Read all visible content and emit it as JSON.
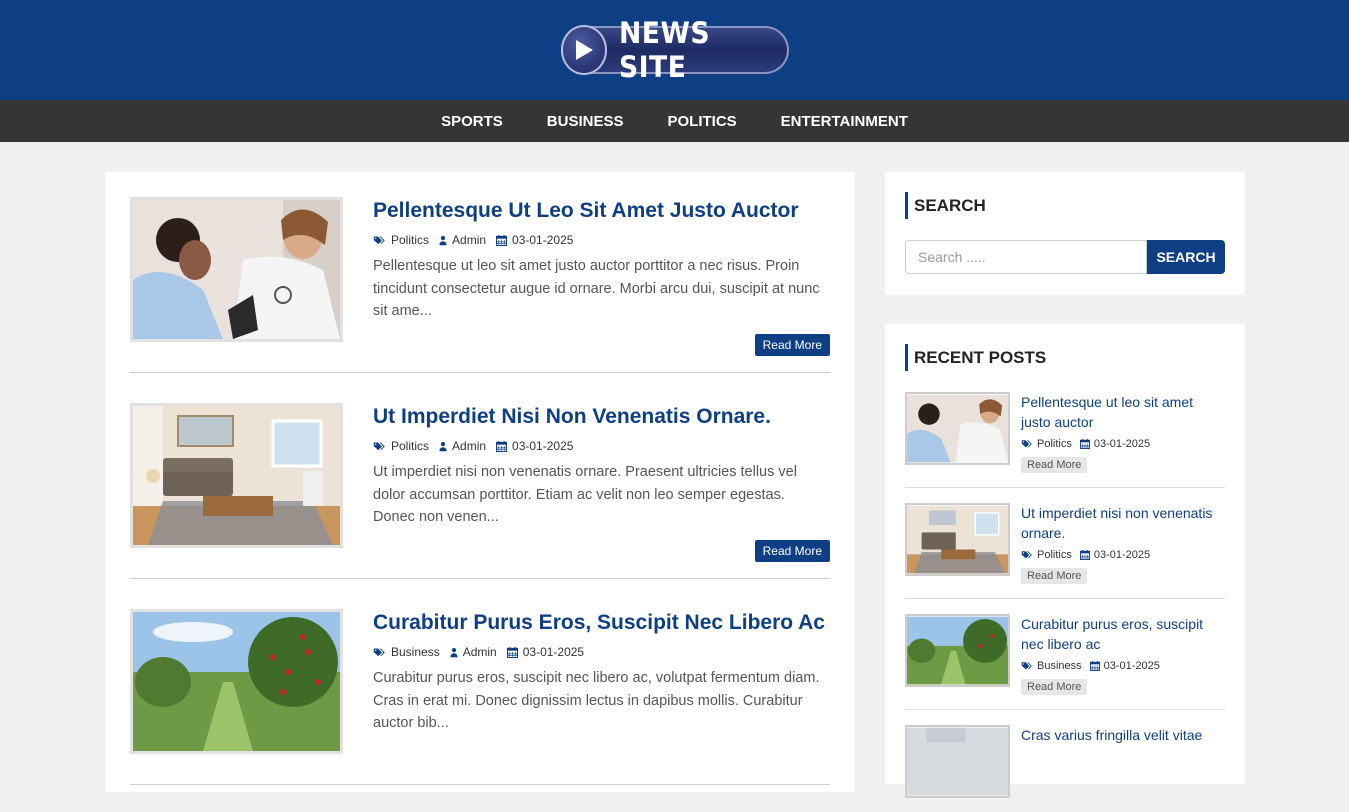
{
  "header": {
    "logo_text": "NEWS SITE"
  },
  "nav": {
    "items": [
      "SPORTS",
      "BUSINESS",
      "POLITICS",
      "ENTERTAINMENT"
    ]
  },
  "posts": [
    {
      "title": "Pellentesque Ut Leo Sit Amet Justo Auctor",
      "category": "Politics",
      "author": "Admin",
      "date": "03-01-2025",
      "excerpt": "Pellentesque ut leo sit amet justo auctor porttitor a nec risus. Proin tincidunt consectetur augue id ornare. Morbi arcu dui, suscipit at nunc sit ame...",
      "read_more": "Read More"
    },
    {
      "title": "Ut Imperdiet Nisi Non Venenatis Ornare.",
      "category": "Politics",
      "author": "Admin",
      "date": "03-01-2025",
      "excerpt": "Ut imperdiet nisi non venenatis ornare. Praesent ultricies tellus vel dolor accumsan porttitor. Etiam ac velit non leo semper egestas. Donec non venen...",
      "read_more": "Read More"
    },
    {
      "title": "Curabitur Purus Eros, Suscipit Nec Libero Ac",
      "category": "Business",
      "author": "Admin",
      "date": "03-01-2025",
      "excerpt": "Curabitur purus eros, suscipit nec libero ac, volutpat fermentum diam. Cras in erat mi. Donec dignissim lectus in dapibus mollis. Curabitur auctor bib...",
      "read_more": "Read More"
    }
  ],
  "sidebar": {
    "search": {
      "title": "SEARCH",
      "placeholder": "Search .....",
      "button": "SEARCH"
    },
    "recent": {
      "title": "RECENT POSTS",
      "items": [
        {
          "title": "Pellentesque ut leo sit amet justo auctor",
          "category": "Politics",
          "date": "03-01-2025",
          "read_more": "Read More"
        },
        {
          "title": "Ut imperdiet nisi non venenatis ornare.",
          "category": "Politics",
          "date": "03-01-2025",
          "read_more": "Read More"
        },
        {
          "title": "Curabitur purus eros, suscipit nec libero ac",
          "category": "Business",
          "date": "03-01-2025",
          "read_more": "Read More"
        },
        {
          "title": "Cras varius fringilla velit vitae"
        }
      ]
    }
  },
  "colors": {
    "brand": "#0e3f85",
    "nav_bg": "#353535",
    "page_bg": "#f0f0f0"
  }
}
